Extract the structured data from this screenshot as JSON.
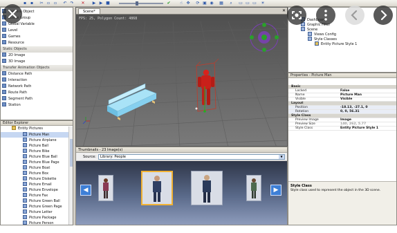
{
  "toolbar": {
    "tab_scene": "Scene*"
  },
  "library": {
    "items": [
      {
        "label": "Camera Object",
        "type": "item"
      },
      {
        "label": "Scene Group",
        "type": "item"
      },
      {
        "label": "Global Variable",
        "type": "item"
      },
      {
        "label": "Level",
        "type": "item"
      },
      {
        "label": "Games",
        "type": "item"
      },
      {
        "label": "Resource",
        "type": "item"
      },
      {
        "label": "Static Objects",
        "type": "group"
      },
      {
        "label": "2D Image",
        "type": "item"
      },
      {
        "label": "3D Image",
        "type": "item"
      },
      {
        "label": "Transfer Animation Objects",
        "type": "group"
      },
      {
        "label": "Distance Path",
        "type": "item"
      },
      {
        "label": "Interaction",
        "type": "item"
      },
      {
        "label": "Network Path",
        "type": "item"
      },
      {
        "label": "Route Path",
        "type": "item"
      },
      {
        "label": "Segment Path",
        "type": "item"
      },
      {
        "label": "Station",
        "type": "item"
      }
    ]
  },
  "editor_explorer": {
    "title": "Editor Explorer",
    "root": "Entity Pictures",
    "items": [
      "Picture Man",
      "Picture Airplane",
      "Picture Ball",
      "Picture Bike",
      "Picture Blue Ball",
      "Picture Blue Page",
      "Picture Boat",
      "Picture Box",
      "Picture Diskette",
      "Picture Email",
      "Picture Envelope",
      "Picture Fax",
      "Picture Green Ball",
      "Picture Green Page",
      "Picture Letter",
      "Picture Package",
      "Picture Person"
    ]
  },
  "viewport": {
    "stats": "FPS: 25, Polygon Count: 4868"
  },
  "thumbnails": {
    "title": "Thumbnails - 23 Image(s)",
    "source_label": "Source:",
    "source_value": "Library: People"
  },
  "scene_tree": {
    "items": [
      "Dashboard",
      "Graphic Filter",
      "Scene",
      "Views Config",
      "Style Classes",
      "Entity Picture Style 1"
    ]
  },
  "properties": {
    "title": "Properties - Picture Man",
    "rows": [
      {
        "k": "Basic",
        "v": "",
        "cat": true
      },
      {
        "k": "Locked",
        "v": "False"
      },
      {
        "k": "Name",
        "v": "Picture Man"
      },
      {
        "k": "Visible",
        "v": "Visible"
      },
      {
        "k": "Layout",
        "v": "",
        "cat": true
      },
      {
        "k": "Position",
        "v": "-18.13, -27.1, 0"
      },
      {
        "k": "Rotation",
        "v": "0, 0, 56.31"
      },
      {
        "k": "Style Class",
        "v": "",
        "cat": true
      },
      {
        "k": "Preview Image",
        "v": "Image"
      },
      {
        "k": "Preview Size",
        "v": "140, 262, 5.77"
      },
      {
        "k": "Style Class",
        "v": "Entity Picture Style 1"
      }
    ],
    "help_title": "Style Class",
    "help_text": "Style class used to represent the object in the 3D scene."
  },
  "colors": {
    "accent_blue": "#3d7fd6",
    "selection_orange": "#f2b233",
    "figure_red": "#d8231c",
    "bench_blue": "#8fd6f2",
    "gizmo_green": "#22b022",
    "gizmo_purple": "#7b3fb5"
  },
  "overlay": {
    "close_icon": "close-icon",
    "lens_icon": "lens-icon",
    "more_icon": "more-vert-icon",
    "prev_icon": "chevron-left-icon",
    "next_icon": "chevron-right-icon"
  }
}
